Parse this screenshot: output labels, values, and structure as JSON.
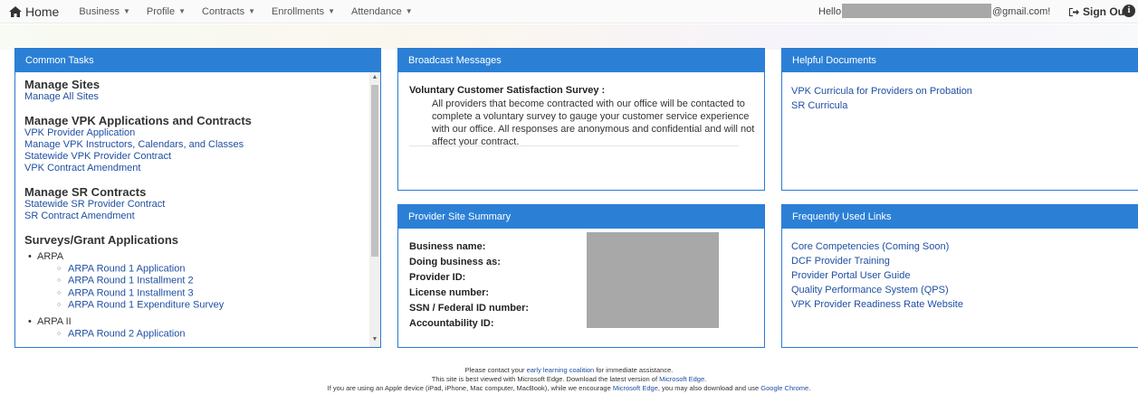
{
  "nav": {
    "home": "Home",
    "items": [
      "Business",
      "Profile",
      "Contracts",
      "Enrollments",
      "Attendance"
    ],
    "hello": "Hello",
    "email_suffix": "@gmail.com!",
    "sign_out": "Sign Out"
  },
  "common_tasks": {
    "title": "Common Tasks",
    "manage_sites": {
      "heading": "Manage Sites",
      "links": [
        "Manage All Sites"
      ]
    },
    "manage_vpk": {
      "heading": "Manage VPK Applications and Contracts",
      "links": [
        "VPK Provider Application",
        "Manage VPK Instructors, Calendars, and Classes",
        "Statewide VPK Provider Contract",
        "VPK Contract Amendment"
      ]
    },
    "manage_sr": {
      "heading": "Manage SR Contracts",
      "links": [
        "Statewide SR Provider Contract",
        "SR Contract Amendment"
      ]
    },
    "surveys": {
      "heading": "Surveys/Grant Applications",
      "groups": [
        {
          "name": "ARPA",
          "links": [
            "ARPA Round 1 Application",
            "ARPA Round 1 Installment 2",
            "ARPA Round 1 Installment 3",
            "ARPA Round 1 Expenditure Survey"
          ]
        },
        {
          "name": "ARPA II",
          "links": [
            "ARPA Round 2 Application"
          ]
        }
      ]
    }
  },
  "broadcast": {
    "title": "Broadcast Messages",
    "message_title": "Voluntary Customer Satisfaction Survey :",
    "message_text": "All providers that become contracted with our office will be contacted to complete a voluntary survey to gauge your customer service experience with our office. All responses are anonymous and confidential and will not affect your contract."
  },
  "provider_summary": {
    "title": "Provider Site Summary",
    "labels": [
      "Business name:",
      "Doing business as:",
      "Provider ID:",
      "License number:",
      "SSN / Federal ID number:",
      "Accountability ID:"
    ]
  },
  "helpful_docs": {
    "title": "Helpful Documents",
    "links": [
      "VPK Curricula for Providers on Probation",
      "SR Curricula"
    ]
  },
  "frequent_links": {
    "title": "Frequently Used Links",
    "links": [
      "Core Competencies (Coming Soon)",
      "DCF Provider Training",
      "Provider Portal User Guide",
      "Quality Performance System (QPS)",
      "VPK Provider Readiness Rate Website"
    ]
  },
  "footer": {
    "l1_pre": "Please contact your ",
    "l1_link": "early learning coalition",
    "l1_post": " for immediate assistance.",
    "l2_pre": "This site is best viewed with Microsoft Edge. Download the latest version of ",
    "l2_link": "Microsoft Edge",
    "l2_post": ".",
    "l3_pre": "If you are using an Apple device (iPad, iPhone, Mac computer, MacBook), while we encourage ",
    "l3_link1": "Microsoft Edge",
    "l3_mid": ", you may also download and use ",
    "l3_link2": "Google Chrome",
    "l3_post": "."
  },
  "colors": {
    "panel_header": "#2b80d6",
    "link": "#1f4fa3"
  }
}
